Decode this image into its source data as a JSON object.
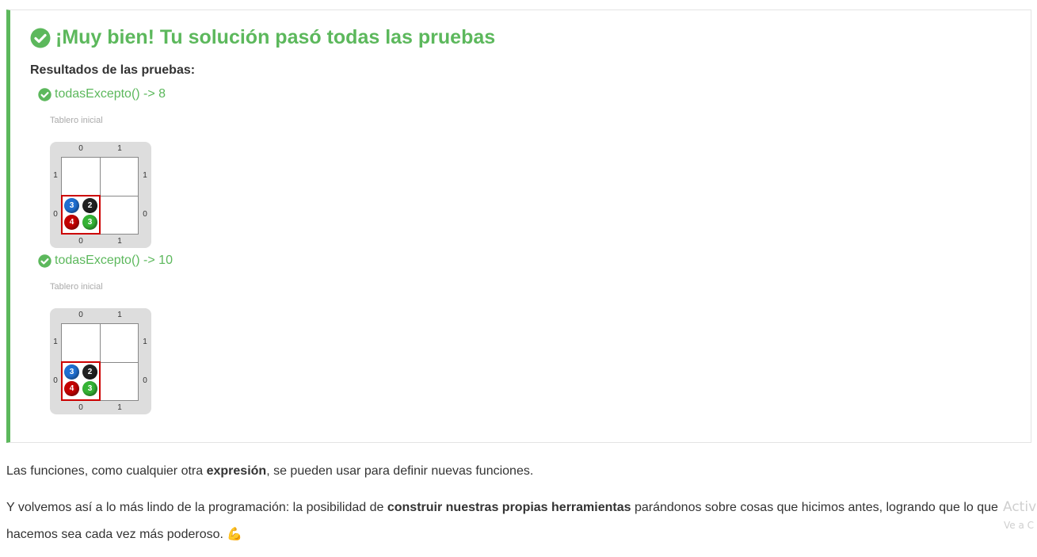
{
  "result": {
    "title": "¡Muy bien! Tu solución pasó todas las pruebas",
    "results_heading": "Resultados de las pruebas:",
    "tests": [
      {
        "label": "todasExcepto() -> 8",
        "board_caption": "Tablero inicial",
        "board": {
          "columns": [
            "0",
            "1"
          ],
          "rows": [
            "1",
            "0"
          ],
          "balls": {
            "blue": "3",
            "black": "2",
            "red": "4",
            "green": "3"
          }
        }
      },
      {
        "label": "todasExcepto() -> 10",
        "board_caption": "Tablero inicial",
        "board": {
          "columns": [
            "0",
            "1"
          ],
          "rows": [
            "1",
            "0"
          ],
          "balls": {
            "blue": "3",
            "black": "2",
            "red": "4",
            "green": "3"
          }
        }
      }
    ]
  },
  "paragraphs": {
    "p1": {
      "before": "Las funciones, como cualquier otra ",
      "bold": "expresión",
      "after": ", se pueden usar para definir nuevas funciones."
    },
    "p2": {
      "before": "Y volvemos así a lo más lindo de la programación: la posibilidad de ",
      "bold": "construir nuestras propias herramientas",
      "after": " parándonos sobre cosas que hicimos antes, logrando que lo que",
      "line2": "hacemos sea cada vez más poderoso.",
      "emoji": "💪"
    }
  },
  "watermark": {
    "line1": "Activ",
    "line2": "Ve a C"
  },
  "colors": {
    "success": "#5cb85c",
    "ball_blue": "#1f6fd1",
    "ball_black": "#222222",
    "ball_red": "#c40000",
    "ball_green": "#35b335",
    "head": "#cc0000"
  }
}
